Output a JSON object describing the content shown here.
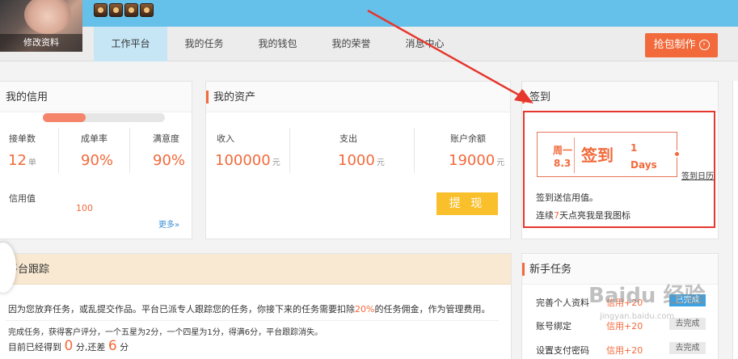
{
  "profile": {
    "edit_label": "修改资料"
  },
  "nav": {
    "items": [
      "工作平台",
      "我的任务",
      "我的钱包",
      "我的荣誉",
      "消息中心"
    ],
    "active_index": 0,
    "pack_button": "抢包制作",
    "pack_icon": "chevron-right-circle-icon"
  },
  "credit": {
    "title": "我的信用",
    "stats": [
      {
        "label": "接单数",
        "value": "12",
        "unit": "单"
      },
      {
        "label": "成单率",
        "value": "90%",
        "unit": ""
      },
      {
        "label": "满意度",
        "value": "90%",
        "unit": ""
      }
    ],
    "credit_label": "信用值",
    "credit_value": "100",
    "credit_fill_fraction": 0.35,
    "more": "更多»"
  },
  "assets": {
    "title": "我的资产",
    "stats": [
      {
        "label": "收入",
        "value": "100000",
        "unit": "元"
      },
      {
        "label": "支出",
        "value": "1000",
        "unit": "元"
      },
      {
        "label": "账户余额",
        "value": "19000",
        "unit": "元"
      }
    ],
    "withdraw": "提 现"
  },
  "sign": {
    "title": "签到",
    "weekday": "周一",
    "date": "8.3",
    "main": "签到",
    "days_num": "1",
    "days_unit": "Days",
    "calendar_link": "签到日历",
    "desc1": "签到送信用值。",
    "desc2_pre": "连续",
    "desc2_num": "7",
    "desc2_post": "天点亮我是我图标"
  },
  "tracking": {
    "title": "平台跟踪",
    "line1_pre": "因为您放弃任务，或乱提交作品。平台已派专人跟踪您的任务，你接下来的任务需要扣除",
    "line1_pct": "20%",
    "line1_post": "的任务佣金，作为管理费用。",
    "line2": "完成任务，获得客户评分，一个五星为2分，一个四星为1分，得满6分，平台跟踪消失。",
    "line3_pre": "目前已经得到",
    "line3_got": "0",
    "line3_mid": "分,还差",
    "line3_need": "6",
    "line3_post": "分"
  },
  "newbie": {
    "title": "新手任务",
    "tasks": [
      {
        "name": "完善个人资料",
        "reward": "信用+20",
        "status": "已完成"
      },
      {
        "name": "账号绑定",
        "reward": "信用+20",
        "status": "去完成"
      },
      {
        "name": "设置支付密码",
        "reward": "信用+20",
        "status": "去完成"
      }
    ]
  },
  "watermark": {
    "main": "Baidu 经验",
    "sub": "jingyan.baidu.com"
  },
  "colors": {
    "accent": "#f26a3b",
    "header": "#65c0ea",
    "highlight": "#e5372d",
    "withdraw": "#f9c02c",
    "done_tag": "#3aa3e3"
  }
}
